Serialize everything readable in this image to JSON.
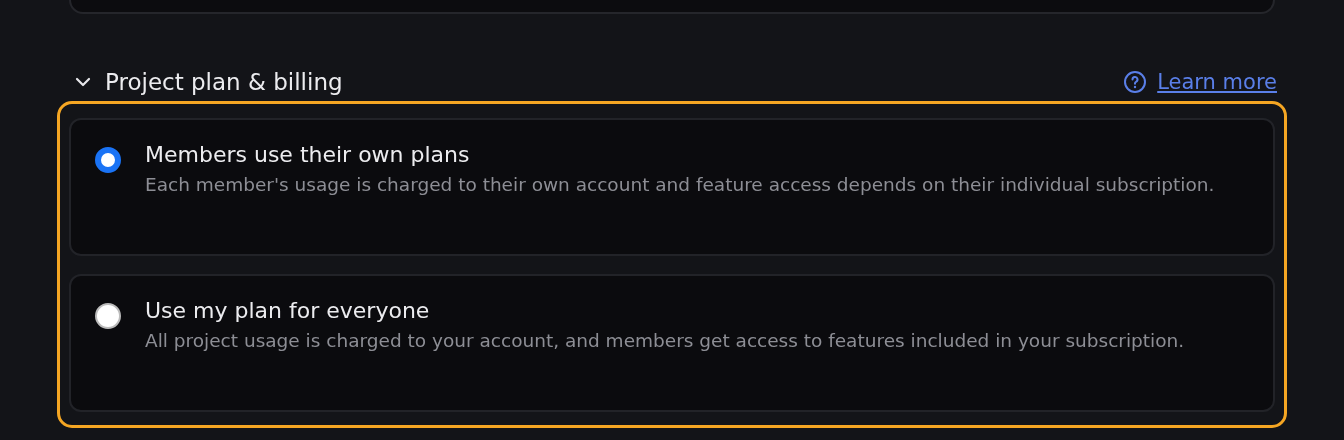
{
  "section": {
    "title": "Project plan & billing",
    "expanded": true,
    "link": "Learn more",
    "options": [
      {
        "title": "Members use their own plans",
        "description": "Each member's usage is charged to their own account and feature access depends on their individual subscription.",
        "selected": true
      },
      {
        "title": "Use my plan for everyone",
        "description": "All project usage is charged to your account, and members get access to features included in your subscription.",
        "selected": false
      }
    ]
  }
}
